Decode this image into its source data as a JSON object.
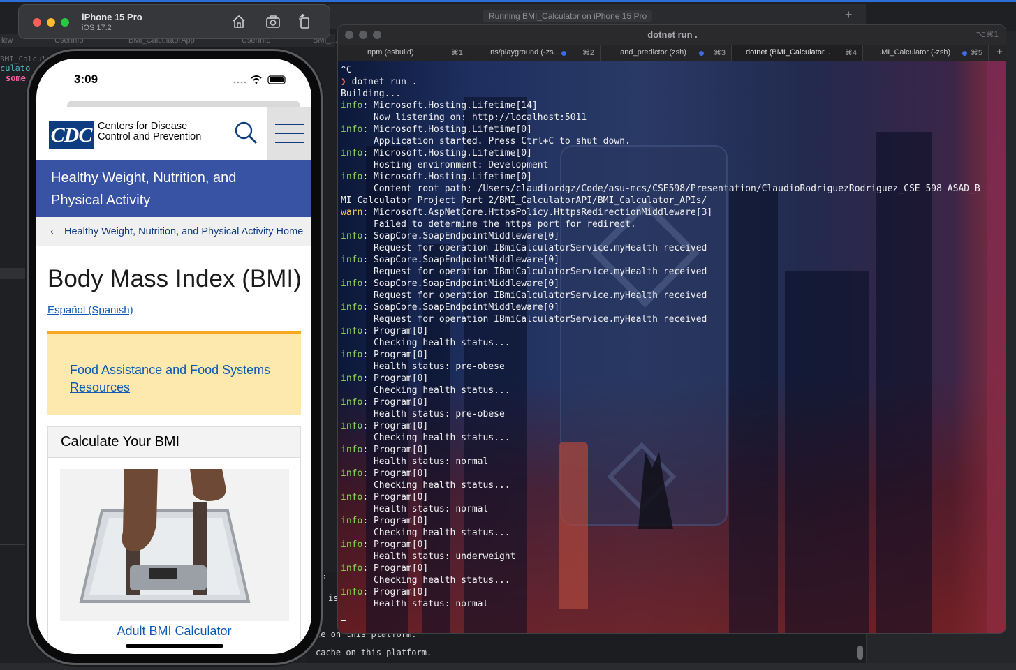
{
  "xcode": {
    "window_title": "Running BMI_Calculator on iPhone 15 Pro",
    "tabs": [
      "iew",
      "UserInfo",
      "BMI_CalculatorApp",
      "UserInfo",
      "BMI_..."
    ],
    "left_code": [
      "BMI_Calcul",
      "culato",
      "some"
    ],
    "console_lines": [
      "8E-",
      "is",
      "he on this platform.",
      "cache on this platform."
    ]
  },
  "simulator": {
    "device_name": "iPhone 15 Pro",
    "os_version": "iOS 17.2",
    "status_time": "3:09",
    "icons": [
      "home-icon",
      "screenshot-icon",
      "rotate-icon"
    ]
  },
  "cdc": {
    "logo_text": "CDC",
    "org_name_line1": "Centers for Disease",
    "org_name_line2": "Control and Prevention",
    "banner_title": "Healthy Weight, Nutrition, and Physical Activity",
    "breadcrumb": "Healthy Weight, Nutrition, and Physical Activity Home",
    "page_title": "Body Mass Index (BMI)",
    "language_link": "Español (Spanish)",
    "alert_link": "Food Assistance and Food Systems Resources",
    "calc_title": "Calculate Your BMI",
    "calc_link": "Adult BMI Calculator"
  },
  "terminal": {
    "title": "dotnet run .",
    "title_shortcut": "⌥⌘1",
    "tabs": [
      {
        "label": "npm (esbuild)",
        "key": "⌘1",
        "active": false,
        "dot": false
      },
      {
        "label": "..ns/playground (-zs...",
        "key": "⌘2",
        "active": false,
        "dot": true
      },
      {
        "label": "..and_predictor (zsh)",
        "key": "⌘3",
        "active": false,
        "dot": true
      },
      {
        "label": "dotnet (BMI_Calculator...",
        "key": "⌘4",
        "active": true,
        "dot": false
      },
      {
        "label": "..MI_Calculator (-zsh)",
        "key": "⌘5",
        "active": false,
        "dot": true
      }
    ],
    "lines": [
      {
        "tag": "",
        "text": "^C"
      },
      {
        "tag": "prompt",
        "text": "dotnet run ."
      },
      {
        "tag": "",
        "text": "Building..."
      },
      {
        "tag": "info",
        "text": ": Microsoft.Hosting.Lifetime[14]"
      },
      {
        "tag": "",
        "text": "      Now listening on: http://localhost:5011"
      },
      {
        "tag": "info",
        "text": ": Microsoft.Hosting.Lifetime[0]"
      },
      {
        "tag": "",
        "text": "      Application started. Press Ctrl+C to shut down."
      },
      {
        "tag": "info",
        "text": ": Microsoft.Hosting.Lifetime[0]"
      },
      {
        "tag": "",
        "text": "      Hosting environment: Development"
      },
      {
        "tag": "info",
        "text": ": Microsoft.Hosting.Lifetime[0]"
      },
      {
        "tag": "",
        "text": "      Content root path: /Users/claudiordgz/Code/asu-mcs/CSE598/Presentation/ClaudioRodriguezRodriguez_CSE 598 ASAD_B"
      },
      {
        "tag": "",
        "text": "MI Calculator Project Part 2/BMI_CalculatorAPI/BMI_Calculator_APIs/"
      },
      {
        "tag": "warn",
        "text": ": Microsoft.AspNetCore.HttpsPolicy.HttpsRedirectionMiddleware[3]"
      },
      {
        "tag": "",
        "text": "      Failed to determine the https port for redirect."
      },
      {
        "tag": "info",
        "text": ": SoapCore.SoapEndpointMiddleware[0]"
      },
      {
        "tag": "",
        "text": "      Request for operation IBmiCalculatorService.myHealth received"
      },
      {
        "tag": "info",
        "text": ": SoapCore.SoapEndpointMiddleware[0]"
      },
      {
        "tag": "",
        "text": "      Request for operation IBmiCalculatorService.myHealth received"
      },
      {
        "tag": "info",
        "text": ": SoapCore.SoapEndpointMiddleware[0]"
      },
      {
        "tag": "",
        "text": "      Request for operation IBmiCalculatorService.myHealth received"
      },
      {
        "tag": "info",
        "text": ": SoapCore.SoapEndpointMiddleware[0]"
      },
      {
        "tag": "",
        "text": "      Request for operation IBmiCalculatorService.myHealth received"
      },
      {
        "tag": "info",
        "text": ": Program[0]"
      },
      {
        "tag": "",
        "text": "      Checking health status..."
      },
      {
        "tag": "info",
        "text": ": Program[0]"
      },
      {
        "tag": "",
        "text": "      Health status: pre-obese"
      },
      {
        "tag": "info",
        "text": ": Program[0]"
      },
      {
        "tag": "",
        "text": "      Checking health status..."
      },
      {
        "tag": "info",
        "text": ": Program[0]"
      },
      {
        "tag": "",
        "text": "      Health status: pre-obese"
      },
      {
        "tag": "info",
        "text": ": Program[0]"
      },
      {
        "tag": "",
        "text": "      Checking health status..."
      },
      {
        "tag": "info",
        "text": ": Program[0]"
      },
      {
        "tag": "",
        "text": "      Health status: normal"
      },
      {
        "tag": "info",
        "text": ": Program[0]"
      },
      {
        "tag": "",
        "text": "      Checking health status..."
      },
      {
        "tag": "info",
        "text": ": Program[0]"
      },
      {
        "tag": "",
        "text": "      Health status: normal"
      },
      {
        "tag": "info",
        "text": ": Program[0]"
      },
      {
        "tag": "",
        "text": "      Checking health status..."
      },
      {
        "tag": "info",
        "text": ": Program[0]"
      },
      {
        "tag": "",
        "text": "      Health status: underweight"
      },
      {
        "tag": "info",
        "text": ": Program[0]"
      },
      {
        "tag": "",
        "text": "      Checking health status..."
      },
      {
        "tag": "info",
        "text": ": Program[0]"
      },
      {
        "tag": "",
        "text": "      Health status: normal"
      },
      {
        "tag": "cursor",
        "text": ""
      }
    ],
    "tag_labels": {
      "info": "info",
      "warn": "warn",
      "prompt": "❯ "
    }
  },
  "colors": {
    "cdc_blue": "#0d3c80",
    "banner_blue": "#3953a4",
    "link_blue": "#0d59b5",
    "alert_bg": "#fde9ae",
    "alert_border": "#f7a823",
    "term_info": "#8fd35a",
    "term_warn": "#f0c94a",
    "term_prompt": "#ff6a3d"
  }
}
